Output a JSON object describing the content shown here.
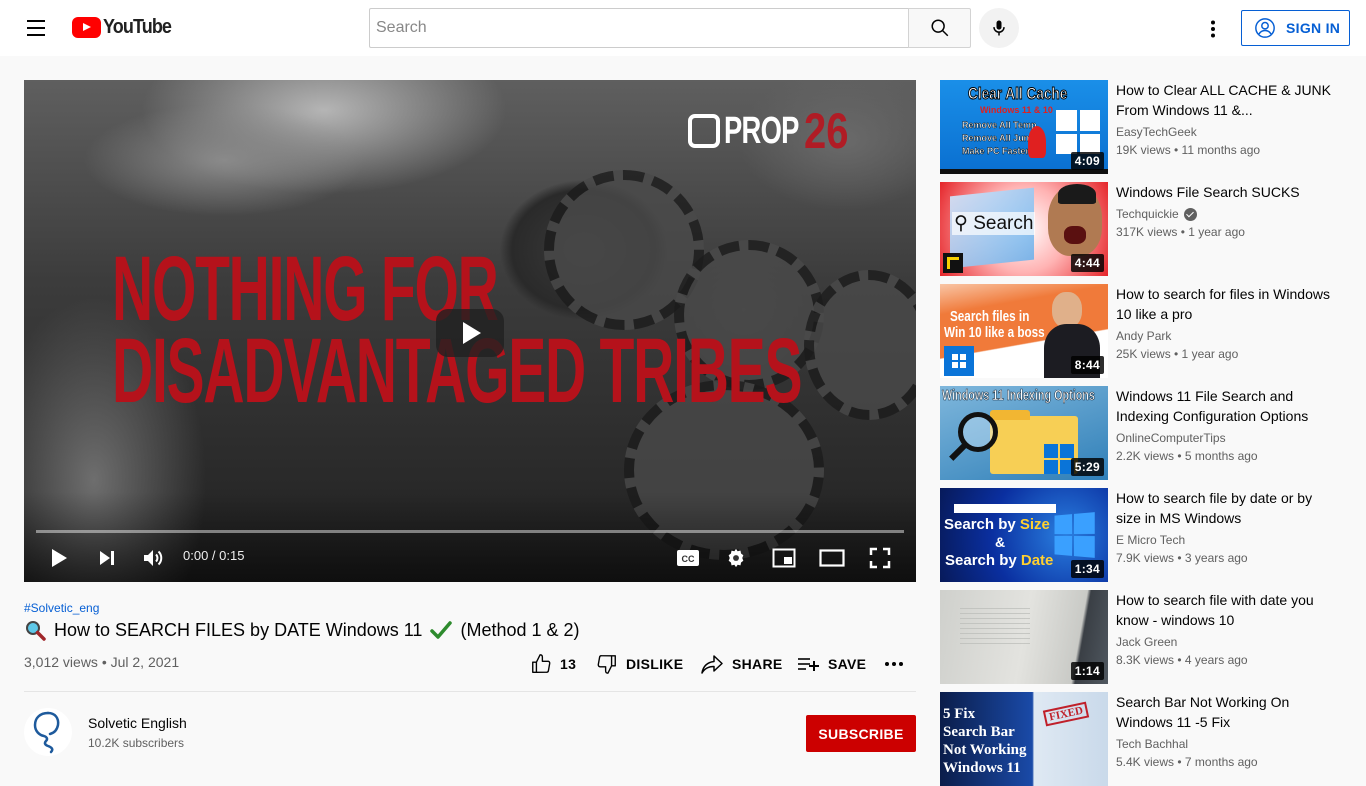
{
  "header": {
    "logo_text": "YouTube",
    "search_placeholder": "Search",
    "signin_label": "SIGN IN"
  },
  "player": {
    "overlay_brand": "PROP",
    "overlay_number": "26",
    "headline_line1": "NOTHING FOR",
    "headline_line2": "DISADVANTAGED TRIBES",
    "time": "0:00 / 0:15",
    "progress_fraction": 0
  },
  "video": {
    "hashtag": "#Solvetic_eng",
    "title": "How to SEARCH FILES by DATE Windows 11",
    "title_suffix": "(Method 1 & 2)",
    "views_date": "3,012 views • Jul 2, 2021",
    "likes": "13",
    "dislike_label": "DISLIKE",
    "share_label": "SHARE",
    "save_label": "SAVE"
  },
  "channel": {
    "name": "Solvetic English",
    "subscribers": "10.2K subscribers",
    "subscribe_label": "SUBSCRIBE",
    "brand_color": "#cc0000"
  },
  "recommendations": [
    {
      "title": "How to Clear ALL CACHE & JUNK From Windows 11 &...",
      "channel": "EasyTechGeek",
      "verified": false,
      "meta": "19K views • 11 months ago",
      "duration": "4:09",
      "thumb_text": [
        "Clear All Cache",
        "Windows 11 & 10",
        "Remove All Temp",
        "Remove All Junk",
        "Make PC Faster"
      ]
    },
    {
      "title": "Windows File Search SUCKS",
      "channel": "Techquickie",
      "verified": true,
      "meta": "317K views • 1 year ago",
      "duration": "4:44",
      "thumb_text": [
        "Search"
      ]
    },
    {
      "title": "How to search for files in Windows 10 like a pro",
      "channel": "Andy Park",
      "verified": false,
      "meta": "25K views • 1 year ago",
      "duration": "8:44",
      "thumb_text": [
        "Search files in",
        "Win 10 like a boss"
      ]
    },
    {
      "title": "Windows 11 File Search and Indexing Configuration Options",
      "channel": "OnlineComputerTips",
      "verified": false,
      "meta": "2.2K views • 5 months ago",
      "duration": "5:29",
      "thumb_text": [
        "Windows 11 Indexing Options"
      ]
    },
    {
      "title": "How to search file by date or by size in MS Windows",
      "channel": "E Micro Tech",
      "verified": false,
      "meta": "7.9K views • 3 years ago",
      "duration": "1:34",
      "thumb_text": [
        "Search by Size",
        "&",
        "Search by Date"
      ]
    },
    {
      "title": "How to search file with date you know - windows 10",
      "channel": "Jack Green",
      "verified": false,
      "meta": "8.3K views • 4 years ago",
      "duration": "1:14",
      "thumb_text": []
    },
    {
      "title": "Search Bar Not Working On Windows 11 -5 Fix",
      "channel": "Tech Bachhal",
      "verified": false,
      "meta": "5.4K views • 7 months ago",
      "duration": "",
      "thumb_text": [
        "5 Fix",
        "Search Bar",
        "Not Working",
        "Windows 11",
        "FIXED"
      ]
    }
  ]
}
